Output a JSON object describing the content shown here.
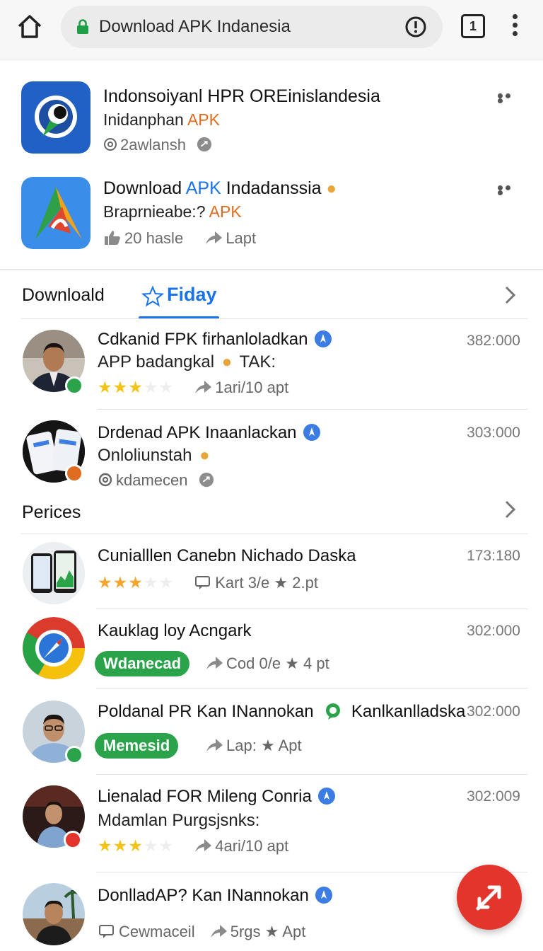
{
  "browser": {
    "url_text": "Download APK Indanesia",
    "tab_count": "1"
  },
  "featured": [
    {
      "title": "Indonsoiyanl HPR OREinislandesia",
      "subtitle_plain": "Inidanphan ",
      "subtitle_accent": "APK",
      "meta": "2awlansh",
      "accent_color": "#e06d1f"
    },
    {
      "title_plain": "Download ",
      "title_accent": "APK",
      "title_rest": " Indadanssia",
      "subtitle_plain": "Braprnieabe:? ",
      "subtitle_accent": "APK",
      "meta_count": "20 hasle",
      "meta_action": "Lapt"
    }
  ],
  "tabs": {
    "download_label": "Downloald",
    "friday_label": "Fiday"
  },
  "list1": [
    {
      "title": "Cdkanid FPK firhanloladkan",
      "subtitle": "APP badangkal",
      "subtitle_tag": "TAK:",
      "rating": 3,
      "meta": "1ari/10 apt",
      "count": "382:000"
    },
    {
      "title": "Drdenad APK Inaanlackan",
      "subtitle": "Onloliunstah",
      "meta": "kdamecen",
      "count": "303:000"
    }
  ],
  "section2": {
    "title": "Perices"
  },
  "list2": [
    {
      "title": "Cunialllen Canebn Nichado Daska",
      "rating": 3,
      "meta": "Kart 3/e",
      "meta_tail": "2.pt",
      "count": "173:180"
    },
    {
      "title": "Kauklag loy Acngark",
      "pill": "Wdanecad",
      "meta": "Cod 0/e",
      "meta_tail": "4 pt",
      "count": "302:000"
    },
    {
      "title": "Poldanal PR Kan INannokan",
      "title_tail": "Kanlkanlladska",
      "pill": "Memesid",
      "meta": "Lap:",
      "meta_tail": "Apt",
      "count": "302:000"
    },
    {
      "title": "Lienalad FOR Mileng Conria",
      "subtitle": "Mdamlan Purgsjsnks:",
      "rating": 3,
      "meta": "4ari/10 apt",
      "count": "302:009"
    },
    {
      "title": "DonlladAP? Kan INannokan",
      "meta": "Cewmaceil",
      "meta_mid": "5rgs",
      "meta_tail": "Apt"
    }
  ],
  "colors": {
    "accent_blue": "#1a73e8",
    "accent_orange": "#e06d1f",
    "green": "#2aa34a",
    "fab_red": "#e3352c",
    "star": "#f3c316"
  },
  "icons": [
    "home-icon",
    "lock-icon",
    "info-icon",
    "tabs-icon",
    "more-vert-icon",
    "more-horiz-icon",
    "star-outline-icon",
    "chevron-right-icon",
    "verified-icon",
    "share-icon",
    "thumb-icon",
    "comment-icon",
    "at-icon",
    "edit-fab-icon"
  ]
}
